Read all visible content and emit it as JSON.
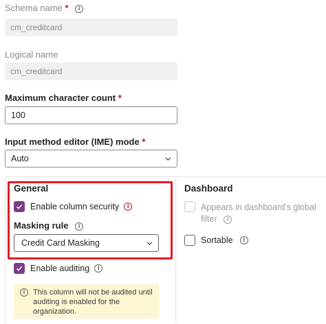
{
  "schema_name": {
    "label": "Schema name",
    "required_mark": "*",
    "value": "cm_creditcard"
  },
  "logical_name": {
    "label": "Logical name",
    "value": "cm_creditcard"
  },
  "max_char_count": {
    "label": "Maximum character count",
    "required_mark": "*",
    "value": "100"
  },
  "ime_mode": {
    "label": "Input method editor (IME) mode",
    "required_mark": "*",
    "value": "Auto"
  },
  "general": {
    "title": "General",
    "column_security": {
      "label": "Enable column security",
      "checked": true
    },
    "masking_rule": {
      "label": "Masking rule",
      "value": "Credit Card Masking"
    },
    "auditing": {
      "label": "Enable auditing",
      "checked": true
    },
    "audit_notice": "This column will not be audited until auditing is enabled for the organization."
  },
  "dashboard": {
    "title": "Dashboard",
    "global_filter": {
      "label_line1": "Appears in dashboard's global",
      "label_line2": "filter",
      "checked": false,
      "disabled": true
    },
    "sortable": {
      "label": "Sortable",
      "checked": false
    }
  },
  "colors": {
    "accent": "#7b3d86",
    "highlight": "#e01b24",
    "required": "#c50f1f",
    "notice_bg": "#fdf6d3"
  }
}
